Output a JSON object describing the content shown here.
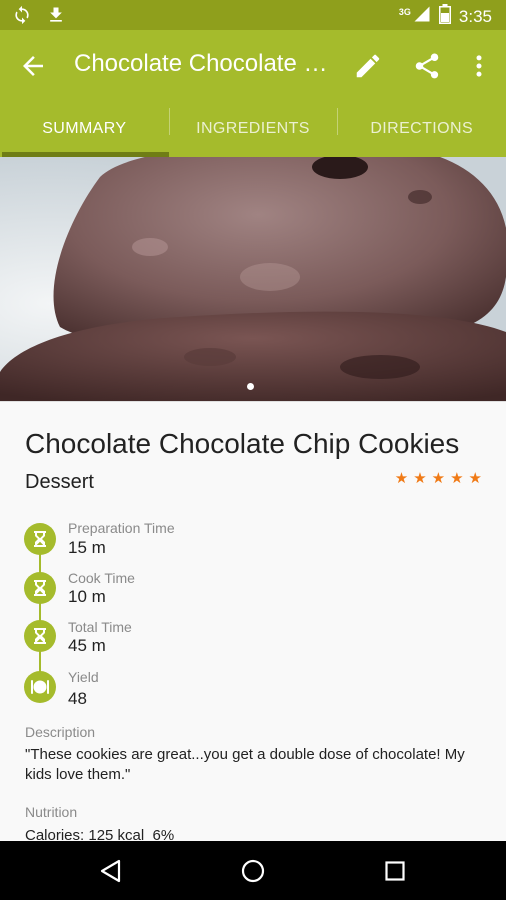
{
  "status_bar": {
    "network_type": "3G",
    "time": "3:35",
    "icons": [
      "sync-icon",
      "download-icon",
      "signal-icon",
      "battery-icon"
    ]
  },
  "app_bar": {
    "title": "Chocolate Chocolate Chip Cookies",
    "icons": [
      "back-arrow-icon",
      "edit-pencil-icon",
      "share-icon",
      "more-vert-icon"
    ]
  },
  "tabs": [
    {
      "label": "SUMMARY",
      "active": true
    },
    {
      "label": "INGREDIENTS",
      "active": false
    },
    {
      "label": "DIRECTIONS",
      "active": false
    }
  ],
  "gallery": {
    "pages": 1,
    "current_page": 1
  },
  "recipe": {
    "title": "Chocolate Chocolate Chip Cookies",
    "category": "Dessert",
    "rating": 5,
    "rating_max": 5
  },
  "times": [
    {
      "label": "Preparation Time",
      "value": "15 m",
      "icon": "hourglass-icon"
    },
    {
      "label": "Cook Time",
      "value": "10 m",
      "icon": "hourglass-icon"
    },
    {
      "label": "Total Time",
      "value": "45 m",
      "icon": "hourglass-icon"
    },
    {
      "label": "Yield",
      "value": "48",
      "icon": "plate-icon"
    }
  ],
  "description": {
    "label": "Description",
    "text": "\"These cookies are great...you get a double dose of chocolate! My kids love them.\""
  },
  "nutrition": {
    "label": "Nutrition",
    "text": "Calories: 125 kcal  6%"
  },
  "nav_bar": {
    "icons": [
      "back-triangle-icon",
      "home-circle-icon",
      "recents-square-icon"
    ]
  },
  "colors": {
    "app_bar": "#a5bb2c",
    "status_bar": "#8f9f1c",
    "tab_indicator": "#6f7d15",
    "star": "#f07a16"
  }
}
